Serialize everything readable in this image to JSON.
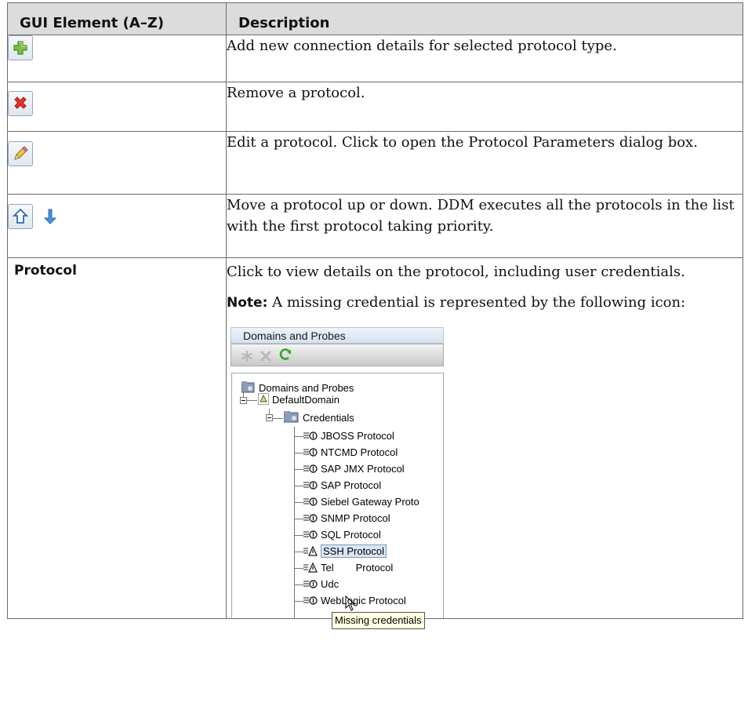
{
  "table": {
    "headers": [
      "GUI Element (A–Z)",
      "Description"
    ],
    "rows": [
      {
        "element_icon": "add-icon",
        "description": "Add new connection details for selected protocol type."
      },
      {
        "element_icon": "remove-icon",
        "description": "Remove a protocol."
      },
      {
        "element_icon": "edit-pencil-icon",
        "description": "Edit a protocol. Click to open the Protocol Parameters dialog box."
      },
      {
        "element_icon": "up-down-arrows-icon",
        "description": "Move a protocol up or down. DDM executes all the protocols in the list with the first protocol taking priority."
      },
      {
        "element_label": "Protocol",
        "description": "Click to view details on the protocol, including user credentials.",
        "note_label": "Note:",
        "note_text": " A missing credential is represented by the following icon:"
      }
    ]
  },
  "screenshot": {
    "panel_title": "Domains and Probes",
    "toolbar_icons": [
      "asterisk-icon",
      "x-icon",
      "refresh-icon"
    ],
    "tree": {
      "root": "Domains and Probes",
      "domain": "DefaultDomain",
      "folder": "Credentials",
      "items": [
        "JBOSS Protocol",
        "NTCMD Protocol",
        "SAP JMX Protocol",
        "SAP Protocol",
        "Siebel Gateway Proto",
        "SNMP Protocol",
        "SQL Protocol",
        "SSH Protocol",
        "Tel",
        "Udc",
        "WebLogic Protocol"
      ],
      "item_suffixes": [
        "",
        "",
        "",
        "",
        "",
        "",
        "",
        "",
        "Protocol",
        "",
        ""
      ],
      "missing_credentials": [
        7,
        8
      ]
    },
    "tooltip": "Missing credentials"
  },
  "colors": {
    "header_bg": "#dcdcdc",
    "border": "#6b6b6b",
    "tooltip_bg": "#ffffe1"
  }
}
